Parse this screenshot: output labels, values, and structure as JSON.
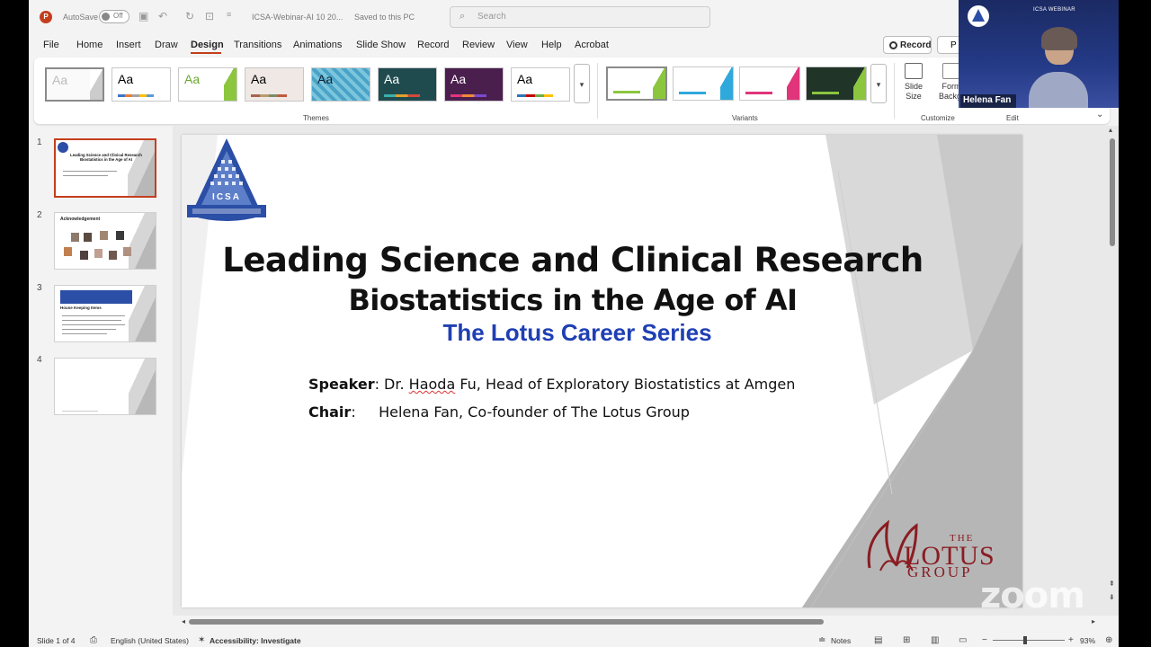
{
  "titlebar": {
    "autosave_label": "AutoSave",
    "autosave_state": "Off",
    "filename": "ICSA-Webinar-AI 10 20...",
    "saved_status": "Saved to this PC",
    "search_placeholder": "Search"
  },
  "menu": {
    "items": [
      "File",
      "Home",
      "Insert",
      "Draw",
      "Design",
      "Transitions",
      "Animations",
      "Slide Show",
      "Record",
      "Review",
      "View",
      "Help",
      "Acrobat"
    ],
    "active": "Design",
    "record_button": "Record",
    "present_button": "P"
  },
  "ribbon": {
    "themes_label": "Themes",
    "variants_label": "Variants",
    "customize_label": "Customize",
    "edit_label": "Edit",
    "theme_sample_text": "Aa",
    "slide_size": "Slide Size",
    "format_background": "Format Background",
    "format_short": "Form",
    "format_short2": "Backgr",
    "slide_line1": "Slide",
    "slide_line2": "Size"
  },
  "thumbnails": [
    {
      "num": "1",
      "title": "Leading Science and Clinical Research Biostatistics in the Age of AI"
    },
    {
      "num": "2",
      "title": "Acknowledgement"
    },
    {
      "num": "3",
      "title": "House Keeping Items"
    },
    {
      "num": "4",
      "title": ""
    }
  ],
  "slide": {
    "title": "Leading Science and Clinical Research",
    "subtitle": "Biostatistics in the Age of AI",
    "series": "The Lotus Career Series",
    "speaker_label": "Speaker",
    "speaker_prefix": ": Dr. ",
    "speaker_firstname": "Haoda",
    "speaker_rest": " Fu, Head of Exploratory Biostatistics at Amgen",
    "chair_label": "Chair",
    "chair_text": ":     Helena Fan, Co-founder of The Lotus Group",
    "icsa_logo_text": "ICSA",
    "lotus_the": "THE",
    "lotus_name": "LOTUS",
    "lotus_group": "GROUP"
  },
  "status": {
    "slide_counter": "Slide 1 of 4",
    "language": "English (United States)",
    "accessibility": "Accessibility: Investigate",
    "notes": "Notes",
    "zoom": "93%"
  },
  "video": {
    "banner": "ICSA WEBINAR",
    "participant": "Helena Fan",
    "watermark": "zoom"
  },
  "colors": {
    "accent": "#c43e1c",
    "series_blue": "#1f3fb3",
    "lotus_red": "#8a1c22"
  }
}
